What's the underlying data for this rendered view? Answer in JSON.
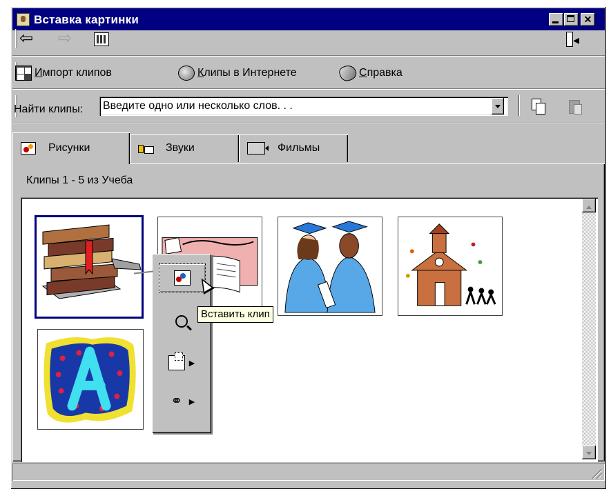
{
  "window": {
    "title": "Вставка картинки"
  },
  "toolbar": {
    "import_prefix": "И",
    "import_rest": "мпорт клипов",
    "online_prefix": "К",
    "online_rest": "липы в Интернете",
    "help_prefix": "С",
    "help_rest": "правка",
    "icons": [
      "back-arrow-icon",
      "forward-arrow-icon",
      "all-categories-icon",
      "autofit-icon",
      "import-clips-icon",
      "clips-online-icon",
      "help-icon",
      "copy-icon",
      "paste-icon"
    ]
  },
  "search": {
    "label": "Найти клипы:",
    "placeholder": "Введите одно или несколько слов. . ."
  },
  "tabs": [
    {
      "label": "Рисунки",
      "icon": "pictures-icon",
      "selected": true
    },
    {
      "label": "Звуки",
      "icon": "sounds-icon",
      "selected": false
    },
    {
      "label": "Фильмы",
      "icon": "movies-icon",
      "selected": false
    }
  ],
  "status": {
    "clips_text": "Клипы 1 - 5 из Учеба"
  },
  "clips": [
    {
      "name": "books",
      "selected": true
    },
    {
      "name": "open-book-with-numbers",
      "selected": false
    },
    {
      "name": "graduates",
      "selected": false
    },
    {
      "name": "schoolhouse",
      "selected": false
    },
    {
      "name": "letter-a",
      "selected": false
    }
  ],
  "clip_menu": {
    "items": [
      "insert-clip-icon",
      "preview-clip-icon",
      "add-to-category-icon",
      "find-similar-icon"
    ],
    "tooltip": "Вставить клип"
  },
  "colors": {
    "titlebar": "#000080",
    "face": "#c0c0c0",
    "selection": "#000080",
    "tooltip": "#ffffe1"
  }
}
